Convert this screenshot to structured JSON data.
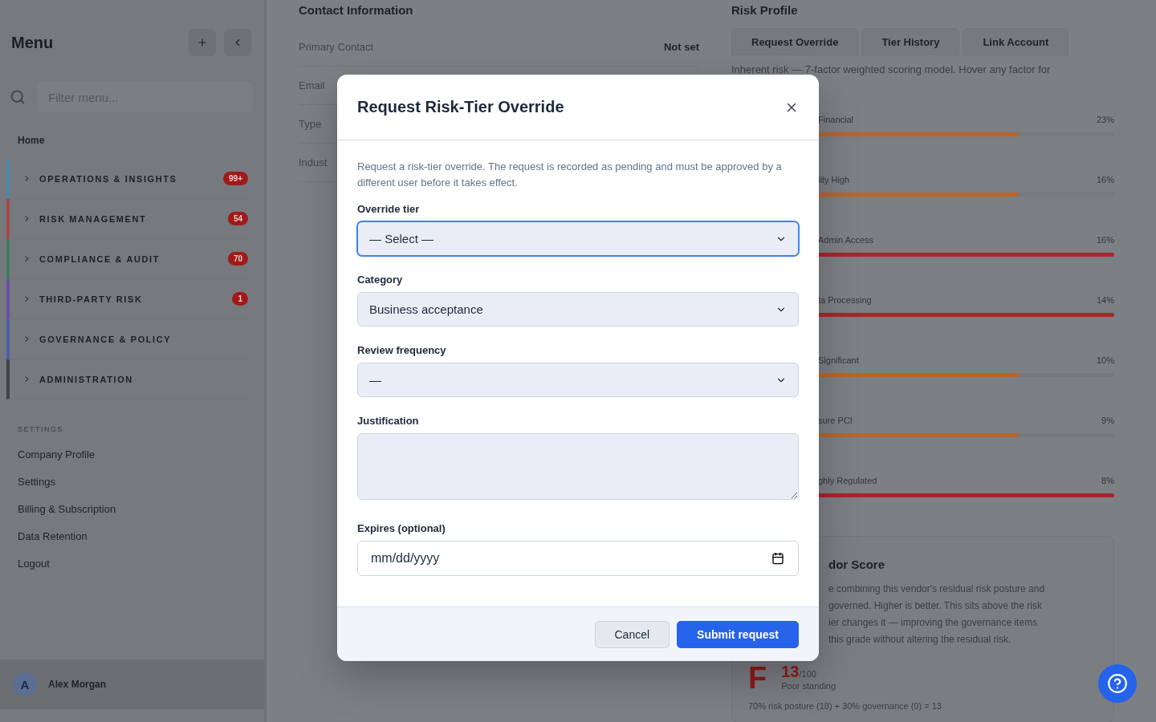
{
  "sidebar": {
    "title": "Menu",
    "search": {
      "placeholder": "Filter menu..."
    },
    "home": "Home",
    "groups": [
      {
        "label": "OPERATIONS & INSIGHTS",
        "badge": "99+",
        "color": "#4f86a8"
      },
      {
        "label": "RISK MANAGEMENT",
        "badge": "54",
        "color": "#a84848"
      },
      {
        "label": "COMPLIANCE & AUDIT",
        "badge": "70",
        "color": "#3f7d62"
      },
      {
        "label": "THIRD-PARTY RISK",
        "badge": "1",
        "color": "#6a4fa8"
      },
      {
        "label": "GOVERNANCE & POLICY",
        "color": "#4a5fa8"
      },
      {
        "label": "ADMINISTRATION",
        "color": "#3f444a"
      }
    ],
    "section": "SETTINGS",
    "links": [
      "Company Profile",
      "Settings",
      "Billing & Subscription",
      "Data Retention",
      "Logout"
    ],
    "user": {
      "initial": "A",
      "name": "Alex Morgan"
    }
  },
  "contact": {
    "title": "Contact Information",
    "rows": [
      {
        "label": "Primary Contact",
        "value": "Not set"
      },
      {
        "label": "Email"
      },
      {
        "label": "Type"
      },
      {
        "label": "Indust"
      }
    ]
  },
  "risk_profile": {
    "title": "Risk Profile",
    "tabs": [
      "Request Override",
      "Tier History",
      "Link Account"
    ],
    "description": "Inherent risk — 7-factor weighted scoring model. Hover any factor for",
    "factors": [
      {
        "label": "Financial",
        "weight": "23%",
        "level": 0.75,
        "color": "#b8652a"
      },
      {
        "label": "lity High",
        "weight": "16%",
        "level": 0.75,
        "color": "#b8652a"
      },
      {
        "label": "Admin Access",
        "weight": "16%",
        "level": 1,
        "color": "#a8262a"
      },
      {
        "label": "ta Processing",
        "weight": "14%",
        "level": 1,
        "color": "#a8262a"
      },
      {
        "label": "Significant",
        "weight": "10%",
        "level": 0.75,
        "color": "#b8652a"
      },
      {
        "label": "sure PCI",
        "weight": "9%",
        "level": 0.75,
        "color": "#b8652a"
      },
      {
        "label": "ghly Regulated",
        "weight": "8%",
        "level": 1,
        "color": "#a8262a"
      }
    ]
  },
  "vendor_score": {
    "title": "dor Score",
    "lines": [
      "e combining this vendor's residual risk posture and",
      "governed. Higher is better. This sits above the risk",
      "ier changes it — improving the governance items",
      "this grade without altering the residual risk."
    ],
    "grade": "F",
    "score": "13",
    "max": "/100",
    "standing": "Poor standing",
    "formula": "70% risk posture (18) + 30% governance (0) = 13"
  },
  "dialog": {
    "title": "Request Risk-Tier Override",
    "description": "Request a risk-tier override. The request is recorded as pending and must be approved by a different user before it takes effect.",
    "fields": [
      {
        "kind": "select",
        "label": "Override tier",
        "value": "— Select —",
        "focused": true
      },
      {
        "kind": "select",
        "label": "Category",
        "value": "Business acceptance",
        "focused": false
      },
      {
        "kind": "select",
        "label": "Review frequency",
        "value": "—",
        "focused": false
      },
      {
        "kind": "textarea",
        "label": "Justification",
        "focused": false
      },
      {
        "kind": "date",
        "label": "Expires (optional)",
        "placeholder": "mm/dd/yyyy",
        "focused": false
      }
    ],
    "buttons": [
      {
        "label": "Cancel",
        "kind": "secondary"
      },
      {
        "label": "Submit request",
        "kind": "primary"
      }
    ]
  }
}
